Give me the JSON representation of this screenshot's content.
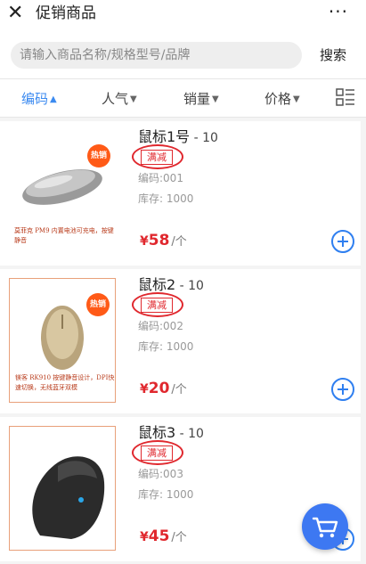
{
  "header": {
    "close_icon": "close-icon",
    "title": "促销商品",
    "more_label": "···"
  },
  "search": {
    "placeholder": "请输入商品名称/规格型号/品牌",
    "value": "",
    "button_label": "搜索"
  },
  "sort": {
    "items": [
      {
        "label": "编码",
        "active": true,
        "arrow": "▲"
      },
      {
        "label": "人气",
        "active": false,
        "arrow": "▼"
      },
      {
        "label": "销量",
        "active": false,
        "arrow": "▼"
      },
      {
        "label": "价格",
        "active": false,
        "arrow": "▼"
      }
    ],
    "layout_icon": "grid-list-icon"
  },
  "products": [
    {
      "name": "鼠标1号",
      "version": " - 10",
      "badge": "满减",
      "code": "编码:001",
      "stock": "库存: 1000",
      "currency": "¥",
      "price": "58",
      "unit": "/个",
      "hot": "热销",
      "desc": "莫菲克 PM9  内置电池可充电，按键静音"
    },
    {
      "name": "鼠标2",
      "version": " - 10",
      "badge": "满减",
      "code": "编码:002",
      "stock": "库存: 1000",
      "currency": "¥",
      "price": "20",
      "unit": "/个",
      "hot": "热销",
      "desc": "镁客 RK910  按键静音设计，DPI快速切换，无线蓝牙双模"
    },
    {
      "name": "鼠标3",
      "version": " - 10",
      "badge": "满减",
      "code": "编码:003",
      "stock": "库存: 1000",
      "currency": "¥",
      "price": "45",
      "unit": "/个"
    }
  ],
  "colors": {
    "accent": "#3b8af0",
    "price": "#e0282e",
    "hot_badge": "#ff5a17",
    "fab": "#3d78f2"
  }
}
